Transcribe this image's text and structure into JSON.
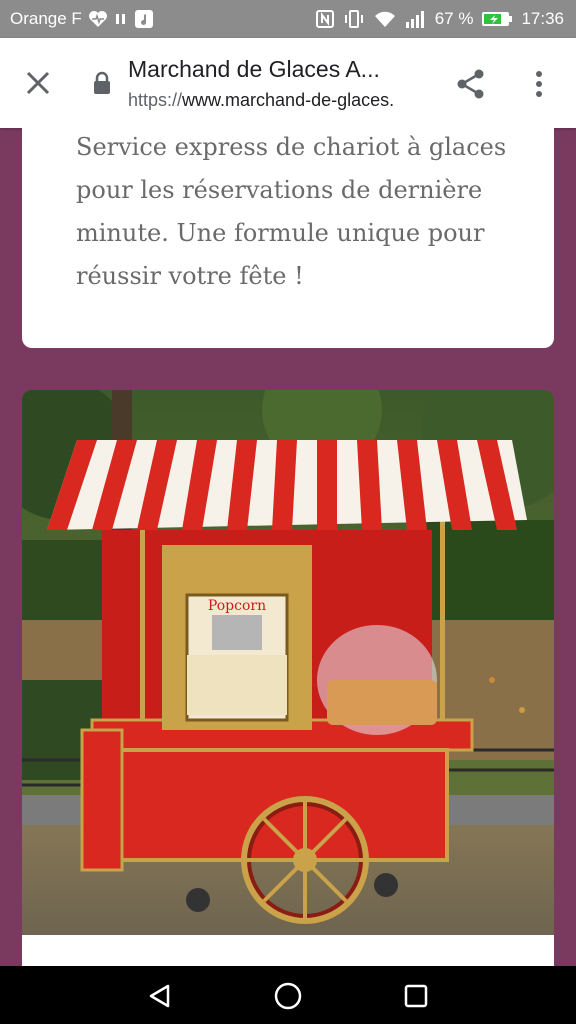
{
  "status_bar": {
    "carrier": "Orange F",
    "battery_percent": "67 %",
    "time": "17:36"
  },
  "browser": {
    "page_title": "Marchand de Glaces A...",
    "url_scheme": "https://",
    "url_host": "www.marchand-de-glaces."
  },
  "content": {
    "description": "Service express de chariot à glaces pour les réservations de dernière minute. Une formule unique pour réussir votre fête !",
    "cart_sign": "Popcorn"
  },
  "colors": {
    "page_background": "#7a3a60",
    "status_bar": "#8c8c8c",
    "cart_red": "#d8281f",
    "awning_white": "#f6f2ea",
    "gold": "#c9a24a"
  }
}
